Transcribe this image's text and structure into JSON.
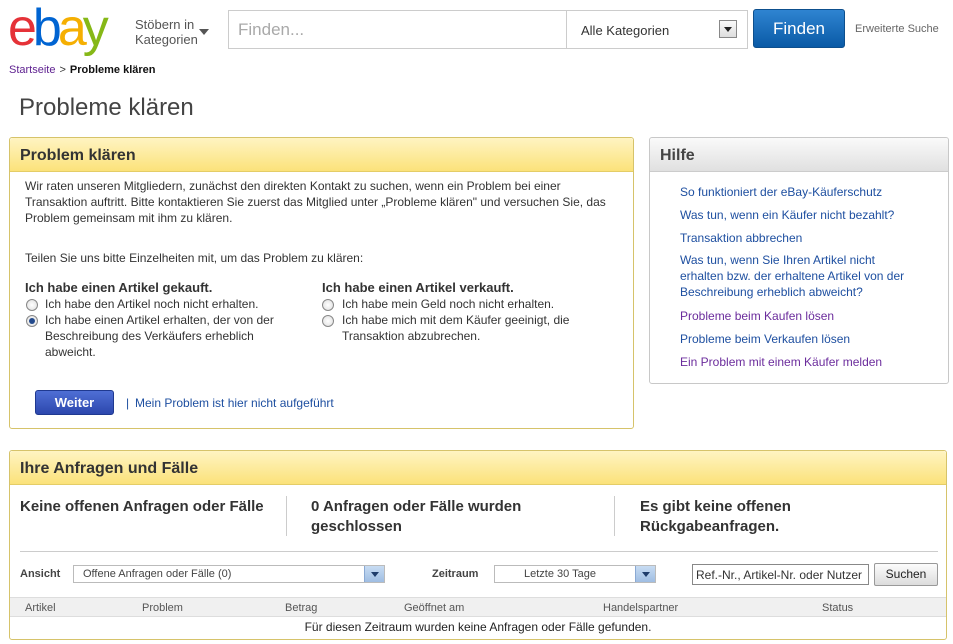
{
  "header": {
    "logo_letters": [
      {
        "char": "e",
        "color": "#e53238"
      },
      {
        "char": "b",
        "color": "#0064d2"
      },
      {
        "char": "a",
        "color": "#f5af02"
      },
      {
        "char": "y",
        "color": "#86b817"
      }
    ],
    "browse_label_1": "Stöbern in",
    "browse_label_2": "Kategorien",
    "search_placeholder": "Finden...",
    "category_selected": "Alle Kategorien",
    "find_button": "Finden",
    "advanced_search": "Erweiterte Suche"
  },
  "breadcrumb": {
    "home": "Startseite",
    "separator": ">",
    "current": "Probleme klären"
  },
  "page_title": "Probleme klären",
  "problem_panel": {
    "title": "Problem klären",
    "intro": "Wir raten unseren Mitgliedern, zunächst den direkten Kontakt zu suchen, wenn ein Problem bei einer Transaktion auftritt. Bitte kontaktieren Sie zuerst das Mitglied unter „Probleme klären\" und versuchen Sie, das Problem gemeinsam mit ihm zu klären.",
    "detail_prompt": "Teilen Sie uns bitte Einzelheiten mit, um das Problem zu klären:",
    "bought_heading": "Ich habe einen Artikel gekauft.",
    "bought_options": [
      {
        "label": "Ich habe den Artikel noch nicht erhalten.",
        "selected": false
      },
      {
        "label": "Ich habe einen Artikel erhalten, der von der Beschreibung des Verkäufers erheblich abweicht.",
        "selected": true
      }
    ],
    "sold_heading": "Ich habe einen Artikel verkauft.",
    "sold_options": [
      {
        "label": "Ich habe mein Geld noch nicht erhalten.",
        "selected": false
      },
      {
        "label": "Ich habe mich mit dem Käufer geeinigt, die Transaktion abzubrechen.",
        "selected": false
      }
    ],
    "continue_button": "Weiter",
    "pipe": "|",
    "not_listed_link": "Mein Problem ist hier nicht aufgeführt"
  },
  "help_panel": {
    "title": "Hilfe",
    "links": [
      {
        "label": "So funktioniert der eBay-Käuferschutz",
        "visited": false
      },
      {
        "label": "Was tun, wenn ein Käufer nicht bezahlt?",
        "visited": false
      },
      {
        "label": "Transaktion abbrechen",
        "visited": false
      },
      {
        "label": "Was tun, wenn Sie Ihren Artikel nicht erhalten bzw. der erhaltene Artikel von der Beschreibung erheblich abweicht?",
        "visited": false
      },
      {
        "label": "Probleme beim Kaufen lösen",
        "visited": true
      },
      {
        "label": "Probleme beim Verkaufen lösen",
        "visited": false
      },
      {
        "label": "Ein Problem mit einem Käufer melden",
        "visited": true
      }
    ]
  },
  "cases_panel": {
    "title": "Ihre Anfragen und Fälle",
    "stat_open": "Keine offenen Anfragen oder Fälle",
    "stat_closed": "0 Anfragen oder Fälle wurden geschlossen",
    "stat_returns": "Es gibt keine offenen Rückgabeanfragen.",
    "view_label": "Ansicht",
    "view_selected": "Offene Anfragen oder Fälle (0)",
    "period_label": "Zeitraum",
    "period_selected": "Letzte 30 Tage",
    "ref_input_value": "Ref.-Nr., Artikel-Nr. oder Nutzer",
    "search_button": "Suchen",
    "columns": [
      "Artikel",
      "Problem",
      "Betrag",
      "Geöffnet am",
      "Handelspartner",
      "Status"
    ],
    "empty_message": "Für diesen Zeitraum wurden keine Anfragen oder Fälle gefunden."
  }
}
